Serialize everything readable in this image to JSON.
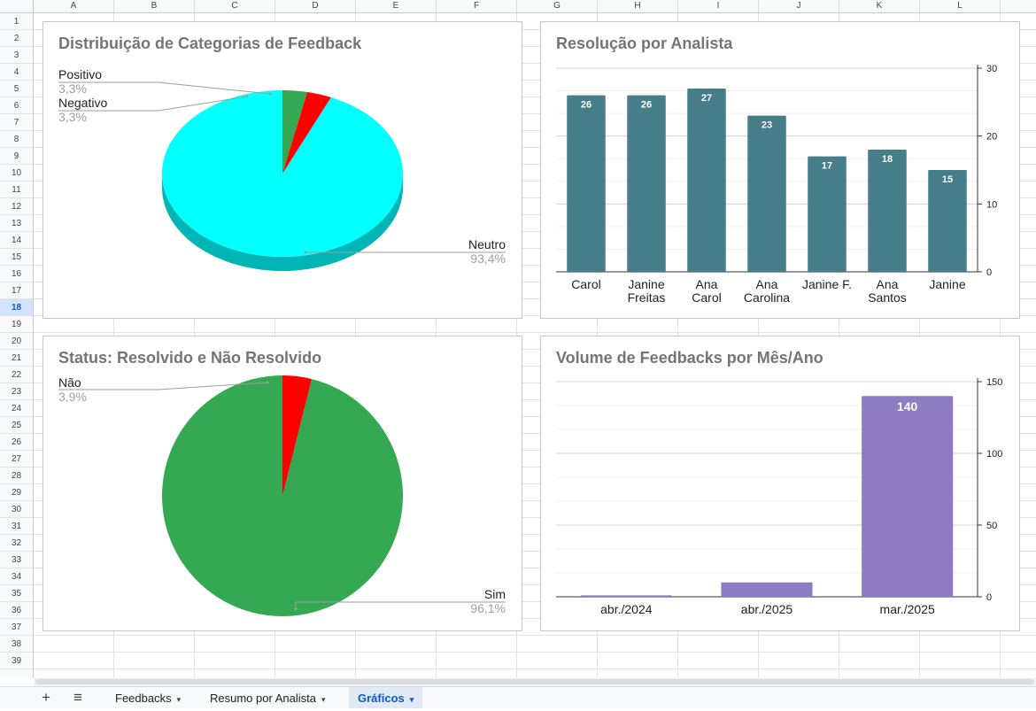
{
  "columns": [
    "A",
    "B",
    "C",
    "D",
    "E",
    "F",
    "G",
    "H",
    "I",
    "J",
    "K",
    "L"
  ],
  "rows": [
    "1",
    "2",
    "3",
    "4",
    "5",
    "6",
    "7",
    "8",
    "9",
    "10",
    "11",
    "12",
    "13",
    "14",
    "15",
    "16",
    "17",
    "18",
    "19",
    "20",
    "21",
    "22",
    "23",
    "24",
    "25",
    "26",
    "27",
    "28",
    "29",
    "30",
    "31",
    "32",
    "33",
    "34",
    "35",
    "36",
    "37",
    "38",
    "39"
  ],
  "selected_row": "18",
  "colors": {
    "cyan": "#00ffff",
    "cyan_side": "#00b5b5",
    "red": "#ff0000",
    "green": "#34a853",
    "teal": "#457d88",
    "purple": "#8e7cc3",
    "active_tab": "#0b57d0"
  },
  "charts": {
    "feedback": {
      "title": "Distribuição de Categorias de Feedback"
    },
    "analyst": {
      "title": "Resolução por Analista"
    },
    "status": {
      "title": "Status: Resolvido e Não Resolvido"
    },
    "volume": {
      "title": "Volume de Feedbacks por Mês/Ano"
    }
  },
  "chart_data": [
    {
      "type": "pie",
      "title": "Distribuição de Categorias de Feedback",
      "three_d": true,
      "slices": [
        {
          "label": "Neutro",
          "value": 93.4,
          "pct_label": "93,4%",
          "color": "#00ffff"
        },
        {
          "label": "Negativo",
          "value": 3.3,
          "pct_label": "3,3%",
          "color": "#ff0000"
        },
        {
          "label": "Positivo",
          "value": 3.3,
          "pct_label": "3,3%",
          "color": "#34a853"
        }
      ]
    },
    {
      "type": "bar",
      "title": "Resolução por Analista",
      "categories": [
        [
          "Carol"
        ],
        [
          "Janine",
          "Freitas"
        ],
        [
          "Ana",
          "Carol"
        ],
        [
          "Ana",
          "Carolina"
        ],
        [
          "Janine F."
        ],
        [
          "Ana",
          "Santos"
        ],
        [
          "Janine"
        ]
      ],
      "values": [
        26,
        26,
        27,
        23,
        17,
        18,
        15
      ],
      "ylim": [
        0,
        30
      ],
      "yticks": [
        0,
        10,
        20,
        30
      ],
      "y_axis_side": "right",
      "grid": true,
      "color": "#457d88"
    },
    {
      "type": "pie",
      "title": "Status: Resolvido e Não Resolvido",
      "slices": [
        {
          "label": "Sim",
          "value": 96.1,
          "pct_label": "96,1%",
          "color": "#34a853"
        },
        {
          "label": "Não",
          "value": 3.9,
          "pct_label": "3,9%",
          "color": "#ff0000"
        }
      ]
    },
    {
      "type": "bar",
      "title": "Volume de Feedbacks por Mês/Ano",
      "categories": [
        [
          "abr./2024"
        ],
        [
          "abr./2025"
        ],
        [
          "mar./2025"
        ]
      ],
      "values": [
        1,
        10,
        140
      ],
      "data_labels": [
        "",
        "",
        "140"
      ],
      "ylim": [
        0,
        150
      ],
      "yticks": [
        0,
        50,
        100,
        150
      ],
      "y_axis_side": "right",
      "grid": true,
      "color": "#8e7cc3"
    }
  ],
  "tabs": [
    {
      "label": "Feedbacks",
      "active": false
    },
    {
      "label": "Resumo por Analista",
      "active": false
    },
    {
      "label": "Gráficos",
      "active": true
    }
  ],
  "tab_buttons": {
    "add": "+",
    "menu": "≡",
    "caret": "▾"
  }
}
